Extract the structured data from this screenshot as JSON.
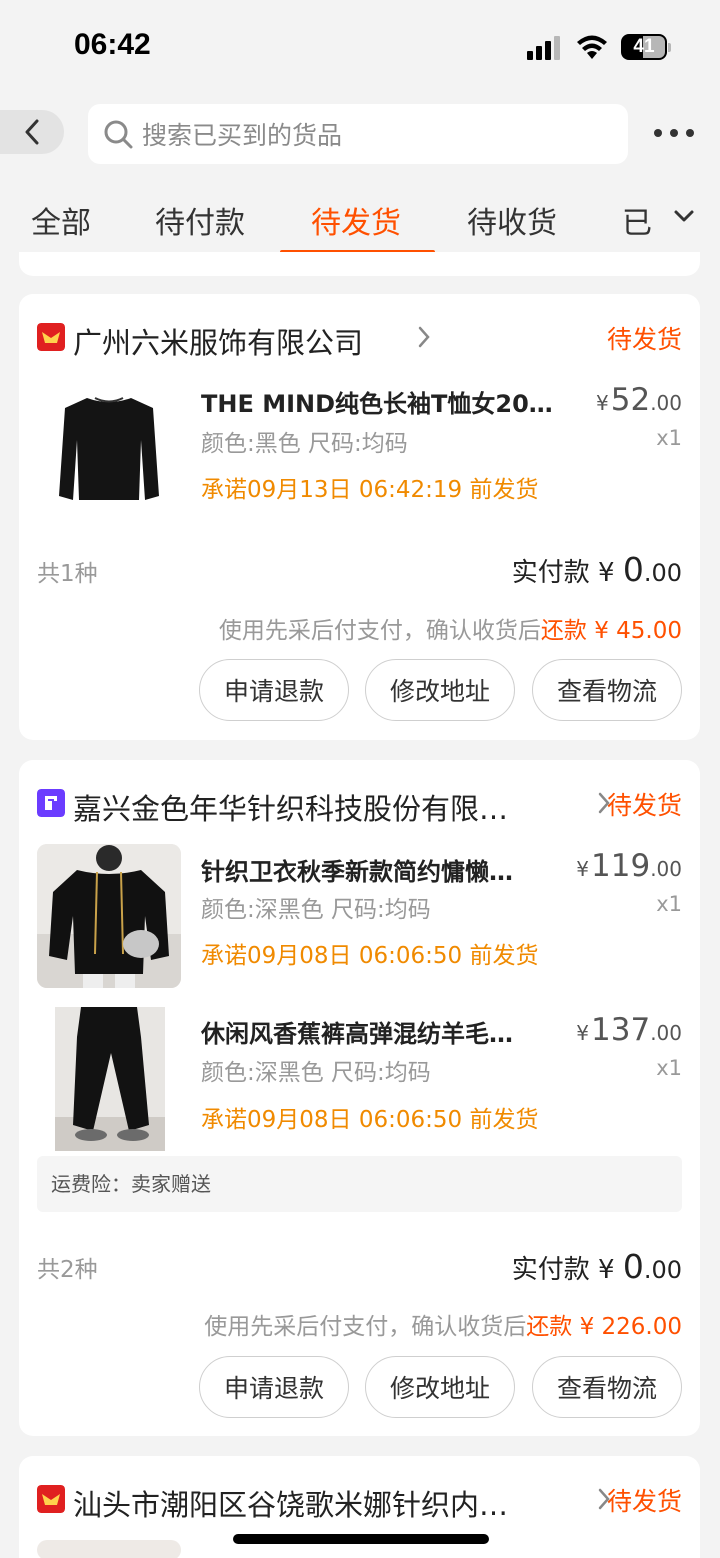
{
  "status_bar": {
    "time": "06:42",
    "battery": "41"
  },
  "header": {
    "search_placeholder": "搜索已买到的货品"
  },
  "tabs": [
    {
      "label": "全部",
      "active": false
    },
    {
      "label": "待付款",
      "active": false
    },
    {
      "label": "待发货",
      "active": true
    },
    {
      "label": "待收货",
      "active": false
    },
    {
      "label": "已",
      "active": false
    }
  ],
  "orders": [
    {
      "store": "广州六米服饰有限公司",
      "status": "待发货",
      "items": [
        {
          "title": "THE MIND纯色长袖T恤女202…",
          "spec": "颜色:黑色 尺码:均码",
          "promise": "承诺09月13日 06:42:19 前发货",
          "price_yuan": "52",
          "price_cents": ".00",
          "qty": "x1"
        }
      ],
      "count": "共1种",
      "paid_label": "实付款",
      "paid_yuan": "0",
      "paid_cents": ".00",
      "note_prefix": "使用先采后付支付，确认收货后",
      "note_refund": "还款 ¥ 45.00",
      "buttons": [
        "申请退款",
        "修改地址",
        "查看物流"
      ]
    },
    {
      "store": "嘉兴金色年华针织科技股份有限…",
      "status": "待发货",
      "items": [
        {
          "title": "针织卫衣秋季新款简约慵懒…",
          "spec": "颜色:深黑色 尺码:均码",
          "promise": "承诺09月08日 06:06:50 前发货",
          "price_yuan": "119",
          "price_cents": ".00",
          "qty": "x1"
        },
        {
          "title": "休闲风香蕉裤高弹混纺羊毛…",
          "spec": "颜色:深黑色 尺码:均码",
          "promise": "承诺09月08日 06:06:50 前发货",
          "price_yuan": "137",
          "price_cents": ".00",
          "qty": "x1"
        }
      ],
      "insurance": "运费险：卖家赠送",
      "count": "共2种",
      "paid_label": "实付款",
      "paid_yuan": "0",
      "paid_cents": ".00",
      "note_prefix": "使用先采后付支付，确认收货后",
      "note_refund": "还款 ¥ 226.00",
      "buttons": [
        "申请退款",
        "修改地址",
        "查看物流"
      ]
    },
    {
      "store": "汕头市潮阳区谷饶歌米娜针织内…",
      "status": "待发货"
    }
  ],
  "currency": "¥",
  "colors": {
    "accent": "#ff5000",
    "promise": "#f08a00"
  }
}
